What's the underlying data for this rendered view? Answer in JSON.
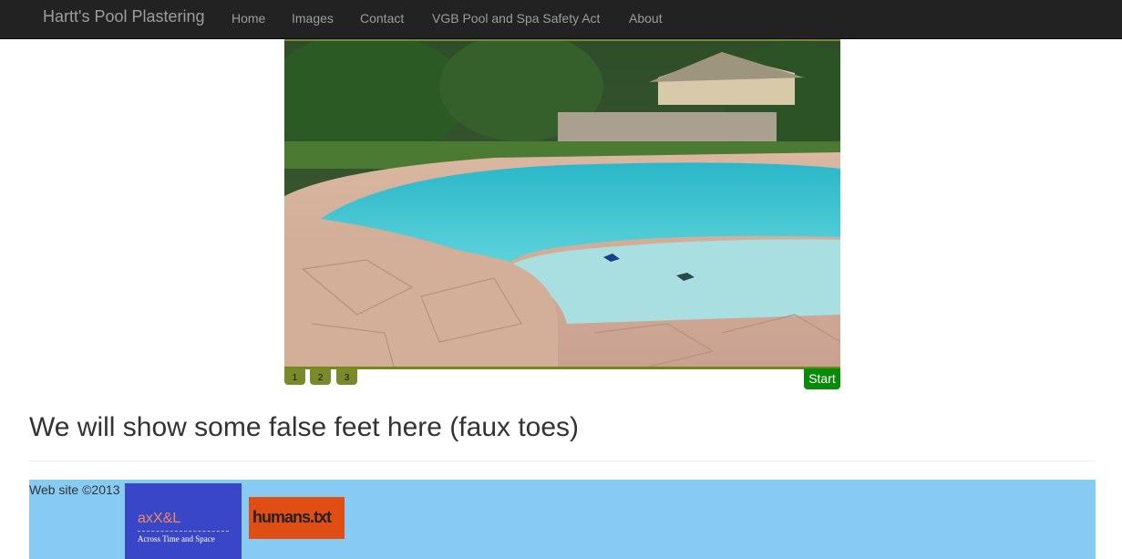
{
  "navbar": {
    "brand": "Hartt's Pool Plastering",
    "links": [
      "Home",
      "Images",
      "Contact",
      "VGB Pool and Spa Safety Act",
      "About"
    ]
  },
  "slider": {
    "image_alt": "Swimming pool with flagstone deck",
    "pager": [
      "1",
      "2",
      "3"
    ],
    "start_label": "Start"
  },
  "content": {
    "headline": "We will show some false feet here (faux toes)"
  },
  "footer": {
    "copyright": "Web site ©2013",
    "badge_axxel": {
      "logo": "axX&L",
      "tagline": "Across Time and Space"
    },
    "badge_humans": {
      "text": "humans.txt"
    }
  },
  "colors": {
    "navbar_bg": "#222222",
    "pager_bg": "#7a8a2a",
    "start_bg": "#0a8a0a",
    "footer_bg": "#87cbf5"
  }
}
